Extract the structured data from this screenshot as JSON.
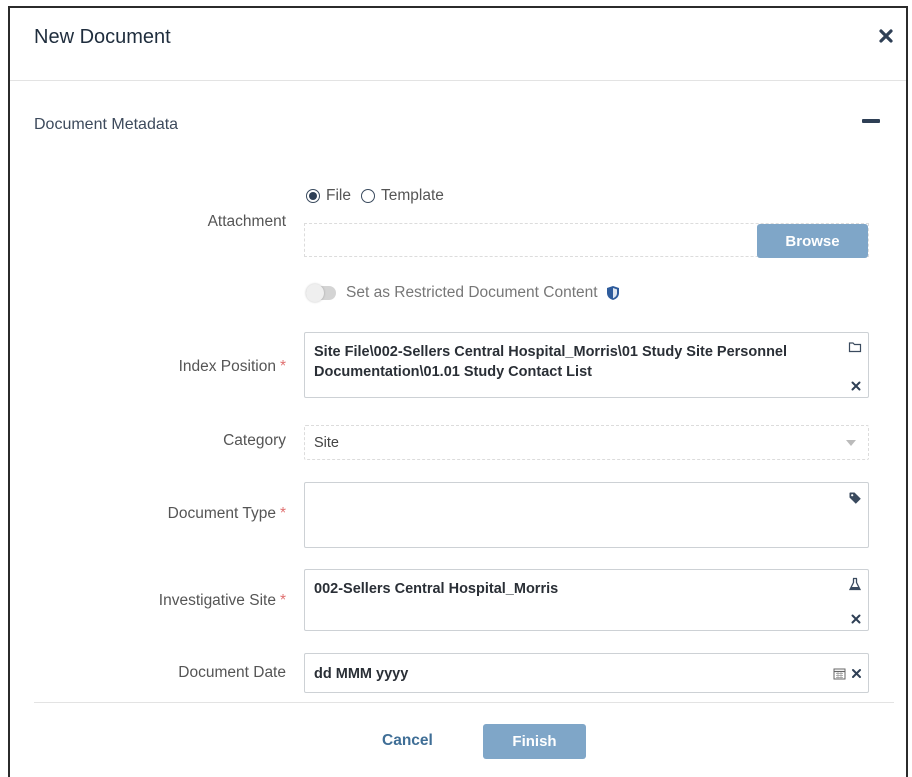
{
  "dialog": {
    "title": "New Document",
    "close_icon": "close-icon"
  },
  "section": {
    "title": "Document Metadata",
    "collapse_icon": "minus-icon"
  },
  "attachment": {
    "label": "Attachment",
    "options": [
      "File",
      "Template"
    ],
    "selected": "File",
    "file_value": "",
    "browse_label": "Browse"
  },
  "restricted": {
    "label": "Set as Restricted Document Content",
    "enabled": false,
    "icon": "shield-icon"
  },
  "index_position": {
    "label": "Index Position",
    "required": "*",
    "value": "Site File\\002-Sellers Central Hospital_Morris\\01 Study Site Personnel Documentation\\01.01 Study Contact List",
    "icon": "folder-icon",
    "clear_icon": "close-icon"
  },
  "category": {
    "label": "Category",
    "value": "Site",
    "icon": "chevron-down-icon"
  },
  "document_type": {
    "label": "Document Type",
    "required": "*",
    "value": "",
    "icon": "tag-icon"
  },
  "investigative_site": {
    "label": "Investigative Site",
    "required": "*",
    "value": "002-Sellers Central Hospital_Morris",
    "icon": "flask-icon",
    "clear_icon": "close-icon"
  },
  "document_date": {
    "label": "Document Date",
    "placeholder": "dd MMM yyyy",
    "icon": "calendar-icon",
    "clear_icon": "close-icon"
  },
  "footer": {
    "cancel_label": "Cancel",
    "finish_label": "Finish"
  },
  "colors": {
    "primary_button": "#7fa6c8",
    "link": "#3f6e96",
    "required": "#e07070"
  }
}
